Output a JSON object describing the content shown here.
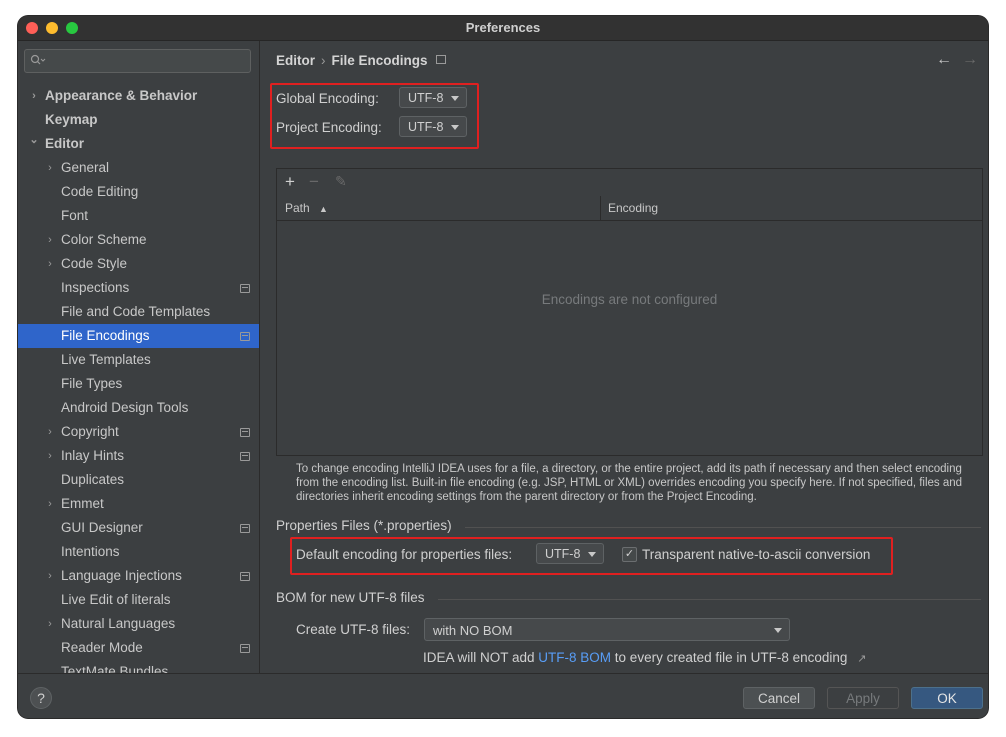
{
  "window": {
    "title": "Preferences"
  },
  "colors": {
    "selection": "#2f65ca",
    "highlight_box": "#e02020",
    "link": "#589df6",
    "ok_button": "#365880"
  },
  "sidebar": {
    "search_placeholder": "",
    "items": [
      {
        "label": "Appearance & Behavior",
        "level": 0,
        "chevron": "right",
        "bold": true,
        "badge": false
      },
      {
        "label": "Keymap",
        "level": 0,
        "chevron": "",
        "bold": true,
        "badge": false
      },
      {
        "label": "Editor",
        "level": 0,
        "chevron": "down",
        "bold": true,
        "badge": false
      },
      {
        "label": "General",
        "level": 1,
        "chevron": "right",
        "badge": false
      },
      {
        "label": "Code Editing",
        "level": 1,
        "chevron": "",
        "badge": false
      },
      {
        "label": "Font",
        "level": 1,
        "chevron": "",
        "badge": false
      },
      {
        "label": "Color Scheme",
        "level": 1,
        "chevron": "right",
        "badge": false
      },
      {
        "label": "Code Style",
        "level": 1,
        "chevron": "right",
        "badge": false
      },
      {
        "label": "Inspections",
        "level": 1,
        "chevron": "",
        "badge": true
      },
      {
        "label": "File and Code Templates",
        "level": 1,
        "chevron": "",
        "badge": false
      },
      {
        "label": "File Encodings",
        "level": 1,
        "chevron": "",
        "badge": true,
        "selected": true
      },
      {
        "label": "Live Templates",
        "level": 1,
        "chevron": "",
        "badge": false
      },
      {
        "label": "File Types",
        "level": 1,
        "chevron": "",
        "badge": false
      },
      {
        "label": "Android Design Tools",
        "level": 1,
        "chevron": "",
        "badge": false
      },
      {
        "label": "Copyright",
        "level": 1,
        "chevron": "right",
        "badge": true
      },
      {
        "label": "Inlay Hints",
        "level": 1,
        "chevron": "right",
        "badge": true
      },
      {
        "label": "Duplicates",
        "level": 1,
        "chevron": "",
        "badge": false
      },
      {
        "label": "Emmet",
        "level": 1,
        "chevron": "right",
        "badge": false
      },
      {
        "label": "GUI Designer",
        "level": 1,
        "chevron": "",
        "badge": true
      },
      {
        "label": "Intentions",
        "level": 1,
        "chevron": "",
        "badge": false
      },
      {
        "label": "Language Injections",
        "level": 1,
        "chevron": "right",
        "badge": true
      },
      {
        "label": "Live Edit of literals",
        "level": 1,
        "chevron": "",
        "badge": false
      },
      {
        "label": "Natural Languages",
        "level": 1,
        "chevron": "right",
        "badge": false
      },
      {
        "label": "Reader Mode",
        "level": 1,
        "chevron": "",
        "badge": true
      },
      {
        "label": "TextMate Bundles",
        "level": 1,
        "chevron": "",
        "badge": false
      }
    ]
  },
  "main": {
    "breadcrumb": {
      "parent": "Editor",
      "sep": "›",
      "current": "File Encodings"
    },
    "global_encoding": {
      "label": "Global Encoding:",
      "value": "UTF-8"
    },
    "project_encoding": {
      "label": "Project Encoding:",
      "value": "UTF-8"
    },
    "table": {
      "add": "+",
      "remove": "−",
      "edit": "✎",
      "columns": [
        "Path",
        "Encoding"
      ],
      "sort_indicator": "▲",
      "empty_text": "Encodings are not configured"
    },
    "help_text": "To change encoding IntelliJ IDEA uses for a file, a directory, or the entire project, add its path if necessary and then select encoding from the encoding list. Built-in file encoding (e.g. JSP, HTML or XML) overrides encoding you specify here. If not specified, files and directories inherit encoding settings from the parent directory or from the Project Encoding.",
    "properties": {
      "section_title": "Properties Files (*.properties)",
      "default_label": "Default encoding for properties files:",
      "default_value": "UTF-8",
      "transparent_label": "Transparent native-to-ascii conversion",
      "transparent_checked": true
    },
    "bom": {
      "section_title": "BOM for new UTF-8 files",
      "create_label": "Create UTF-8 files:",
      "create_value": "with NO BOM",
      "note_prefix": "IDEA will NOT add ",
      "note_link": "UTF-8 BOM",
      "note_suffix": " to every created file in UTF-8 encoding",
      "note_arrow": "↗"
    }
  },
  "footer": {
    "help": "?",
    "cancel": "Cancel",
    "apply": "Apply",
    "ok": "OK"
  }
}
